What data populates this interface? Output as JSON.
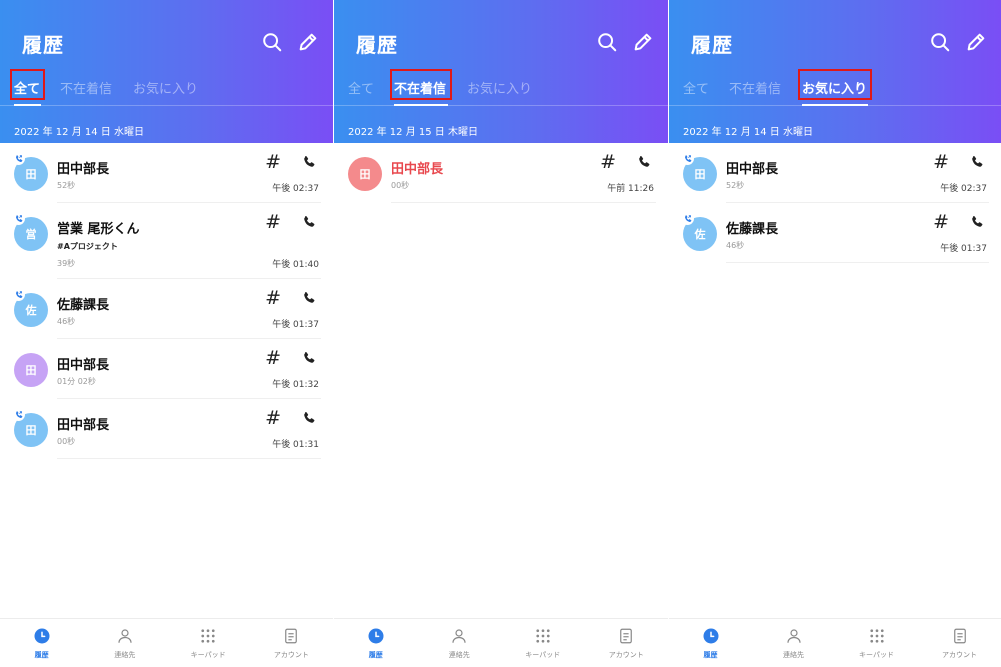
{
  "colors": {
    "accent": "#2e7de8",
    "missed": "#e8484e",
    "highlight": "#e01818"
  },
  "panels": [
    {
      "title": "履歴",
      "tabs": [
        "全て",
        "不在着信",
        "お気に入り"
      ],
      "active_tab": 0,
      "date": "2022 年 12 月 14 日 水曜日",
      "entries": [
        {
          "name": "田中部長",
          "avatar": "田",
          "avatar_color": "#7fc3f5",
          "badge": true,
          "duration": "52秒",
          "time": "午後 02:37",
          "sub": ""
        },
        {
          "name": "営業 尾形くん",
          "avatar": "営",
          "avatar_color": "#7fc3f5",
          "badge": true,
          "duration": "39秒",
          "time": "午後 01:40",
          "sub": "#Aプロジェクト"
        },
        {
          "name": "佐藤課長",
          "avatar": "佐",
          "avatar_color": "#7fc3f5",
          "badge": true,
          "duration": "46秒",
          "time": "午後 01:37",
          "sub": ""
        },
        {
          "name": "田中部長",
          "avatar": "田",
          "avatar_color": "#c6a3f5",
          "badge": false,
          "duration": "01分 02秒",
          "time": "午後 01:32",
          "sub": ""
        },
        {
          "name": "田中部長",
          "avatar": "田",
          "avatar_color": "#7fc3f5",
          "badge": true,
          "duration": "00秒",
          "time": "午後 01:31",
          "sub": ""
        }
      ]
    },
    {
      "title": "履歴",
      "tabs": [
        "全て",
        "不在着信",
        "お気に入り"
      ],
      "active_tab": 1,
      "date": "2022 年 12 月 15 日 木曜日",
      "entries": [
        {
          "name": "田中部長",
          "avatar": "田",
          "avatar_color": "#f48a8c",
          "badge": false,
          "missed": true,
          "duration": "00秒",
          "time": "午前 11:26",
          "sub": ""
        }
      ]
    },
    {
      "title": "履歴",
      "tabs": [
        "全て",
        "不在着信",
        "お気に入り"
      ],
      "active_tab": 2,
      "date": "2022 年 12 月 14 日 水曜日",
      "entries": [
        {
          "name": "田中部長",
          "avatar": "田",
          "avatar_color": "#7fc3f5",
          "badge": true,
          "duration": "52秒",
          "time": "午後 02:37",
          "sub": ""
        },
        {
          "name": "佐藤課長",
          "avatar": "佐",
          "avatar_color": "#7fc3f5",
          "badge": true,
          "duration": "46秒",
          "time": "午後 01:37",
          "sub": ""
        }
      ]
    }
  ],
  "entry_hash": "#",
  "nav": [
    {
      "label": "履歴",
      "icon": "history-clock-icon"
    },
    {
      "label": "連絡先",
      "icon": "person-icon"
    },
    {
      "label": "キーパッド",
      "icon": "keypad-icon"
    },
    {
      "label": "アカウント",
      "icon": "account-document-icon"
    }
  ],
  "icons": {
    "search": "search-icon",
    "edit": "pencil-icon",
    "call": "phone-icon"
  }
}
